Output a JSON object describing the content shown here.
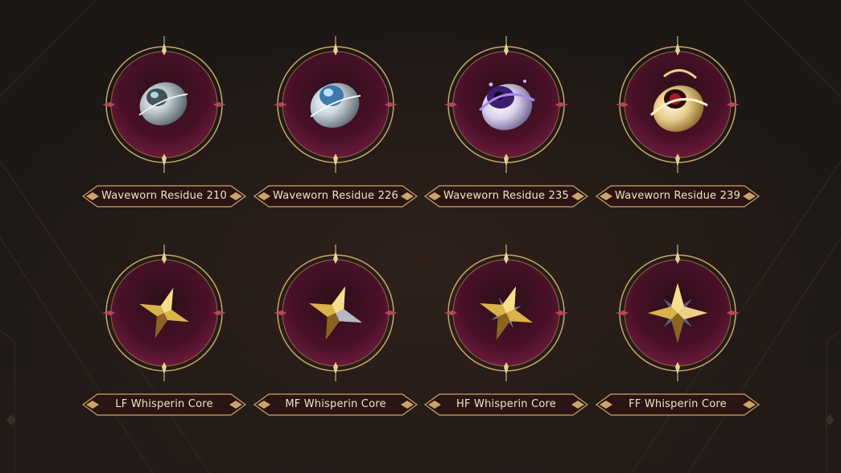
{
  "rows": [
    {
      "items": [
        {
          "label": "Waveworn Residue 210",
          "icon": "waveworn-residue-210-icon",
          "accent": "#9fb8c8"
        },
        {
          "label": "Waveworn Residue 226",
          "icon": "waveworn-residue-226-icon",
          "accent": "#6fa8d8"
        },
        {
          "label": "Waveworn Residue 235",
          "icon": "waveworn-residue-235-icon",
          "accent": "#9a6fe0"
        },
        {
          "label": "Waveworn Residue 239",
          "icon": "waveworn-residue-239-icon",
          "accent": "#e8c878"
        }
      ]
    },
    {
      "items": [
        {
          "label": "LF Whisperin Core",
          "icon": "lf-whisperin-core-icon",
          "accent": "#d9b24a"
        },
        {
          "label": "MF Whisperin Core",
          "icon": "mf-whisperin-core-icon",
          "accent": "#d9b24a"
        },
        {
          "label": "HF Whisperin Core",
          "icon": "hf-whisperin-core-icon",
          "accent": "#d9b24a"
        },
        {
          "label": "FF Whisperin Core",
          "icon": "ff-whisperin-core-icon",
          "accent": "#d9b24a"
        }
      ]
    }
  ],
  "colors": {
    "background": "#1c1815",
    "frame_gold": "#c9a56a",
    "circle_fill": "#5a1432",
    "label_text": "#f1e2c2"
  }
}
